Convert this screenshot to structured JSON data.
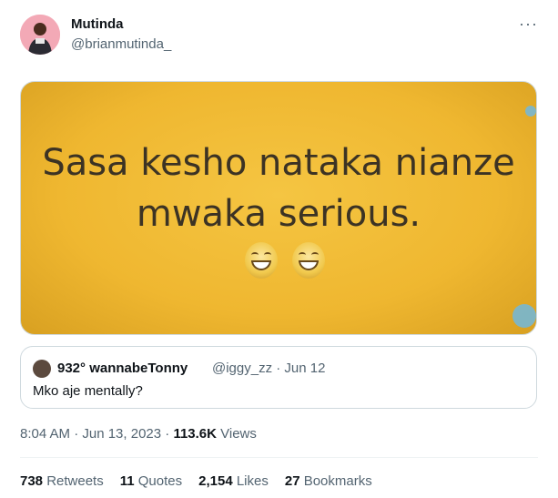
{
  "author": {
    "display_name": "Mutinda",
    "handle": "@brianmutinda_"
  },
  "more_label": "···",
  "media": {
    "caption_line1": "Sasa kesho nataka nianze",
    "caption_line2": "mwaka serious."
  },
  "quoted_tweet": {
    "display_name": "932° wannabeTonny",
    "meta": "@iggy_zz · Jun 12",
    "text": "Mko aje mentally?"
  },
  "timestamp": "8:04 AM · Jun 13, 2023 · ",
  "views": {
    "count": "113.6K",
    "label": " Views"
  },
  "stats": [
    {
      "count": "738",
      "label": " Retweets"
    },
    {
      "count": "11",
      "label": " Quotes"
    },
    {
      "count": "2,154",
      "label": " Likes"
    },
    {
      "count": "27",
      "label": " Bookmarks"
    }
  ],
  "colors": {
    "text_primary": "#0f1419",
    "text_secondary": "#536471",
    "border": "#cfd9de",
    "image_yellow": "#efb730"
  }
}
